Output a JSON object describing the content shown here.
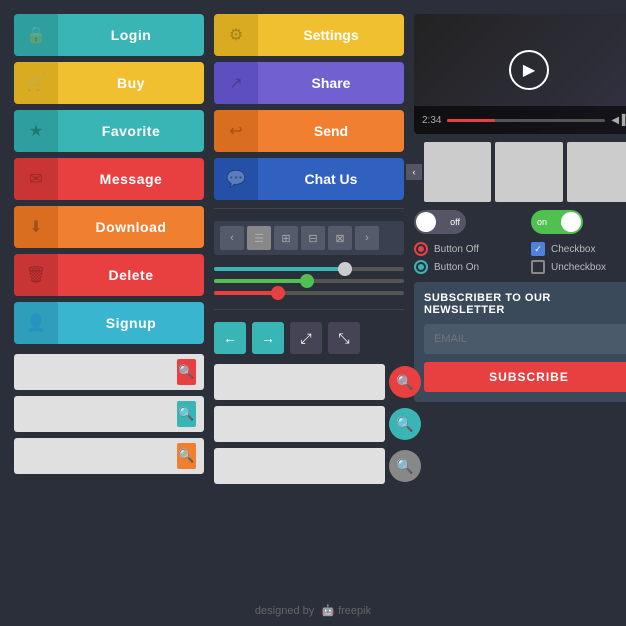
{
  "buttons": {
    "login": "Login",
    "buy": "Buy",
    "favorite": "Favorite",
    "message": "Message",
    "download": "Download",
    "delete": "Delete",
    "signup": "Signup",
    "settings": "Settings",
    "share": "Share",
    "send": "Send",
    "chatus": "Chat Us"
  },
  "search": {
    "placeholder1": "",
    "placeholder2": "",
    "placeholder3": ""
  },
  "video": {
    "time": "2:34",
    "volume": "◀ ▌▌"
  },
  "toggles": {
    "off_label": "off",
    "on_label": "on"
  },
  "radio": {
    "button_off": "Button Off",
    "button_on": "Button On"
  },
  "checkbox": {
    "checkbox": "Checkbox",
    "uncheckbox": "Uncheckbox"
  },
  "newsletter": {
    "title": "SUBSCRIBER TO OUR NEWSLETTER",
    "email_placeholder": "EMAIL",
    "subscribe_btn": "SUBSCRIBE"
  },
  "footer": {
    "text": "designed by",
    "brand": "freepik"
  }
}
